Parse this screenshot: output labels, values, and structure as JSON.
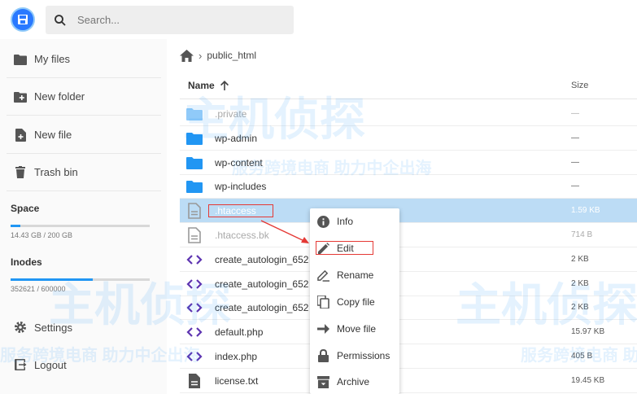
{
  "search": {
    "placeholder": "Search..."
  },
  "sidebar": {
    "items": [
      {
        "label": "My files",
        "icon": "folder-icon"
      },
      {
        "label": "New folder",
        "icon": "folder-plus-icon"
      },
      {
        "label": "New file",
        "icon": "file-plus-icon"
      },
      {
        "label": "Trash bin",
        "icon": "trash-icon"
      }
    ],
    "space": {
      "title": "Space",
      "text": "14.43 GB / 200 GB",
      "fraction": 0.072
    },
    "inodes": {
      "title": "Inodes",
      "text": "352621 / 600000",
      "fraction": 0.588
    },
    "bottom": [
      {
        "label": "Settings",
        "icon": "gear-icon"
      },
      {
        "label": "Logout",
        "icon": "logout-icon"
      }
    ]
  },
  "breadcrumb": {
    "path": "public_html"
  },
  "listing": {
    "name_header": "Name",
    "size_header": "Size",
    "rows": [
      {
        "name": ".private",
        "size": "—",
        "type": "folder",
        "dim": true
      },
      {
        "name": "wp-admin",
        "size": "—",
        "type": "folder"
      },
      {
        "name": "wp-content",
        "size": "—",
        "type": "folder"
      },
      {
        "name": "wp-includes",
        "size": "—",
        "type": "folder"
      },
      {
        "name": ".htaccess",
        "size": "1.59 KB",
        "type": "file",
        "selected": true
      },
      {
        "name": ".htaccess.bk",
        "size": "714 B",
        "type": "file",
        "dim": true
      },
      {
        "name": "create_autologin_652",
        "size": "2 KB",
        "type": "code"
      },
      {
        "name": "create_autologin_652",
        "size": "2 KB",
        "type": "code"
      },
      {
        "name": "create_autologin_652",
        "size": "2 KB",
        "type": "code"
      },
      {
        "name": "default.php",
        "size": "15.97 KB",
        "type": "code"
      },
      {
        "name": "index.php",
        "size": "405 B",
        "type": "code"
      },
      {
        "name": "license.txt",
        "size": "19.45 KB",
        "type": "text"
      }
    ]
  },
  "context_menu": {
    "items": [
      {
        "label": "Info",
        "icon": "info-icon"
      },
      {
        "label": "Edit",
        "icon": "pencil-icon"
      },
      {
        "label": "Rename",
        "icon": "rename-icon"
      },
      {
        "label": "Copy file",
        "icon": "copy-icon"
      },
      {
        "label": "Move file",
        "icon": "arrow-right-icon"
      },
      {
        "label": "Permissions",
        "icon": "lock-icon"
      },
      {
        "label": "Archive",
        "icon": "archive-icon"
      }
    ]
  },
  "watermark": {
    "brand": "主机侦探",
    "tagline": "服务跨境电商 助力中企出海"
  },
  "colors": {
    "accent": "#2196f3",
    "folder": "#2196f3",
    "code": "#5e35b1",
    "selected_row": "#bcdcf5",
    "highlight": "#e53935"
  }
}
